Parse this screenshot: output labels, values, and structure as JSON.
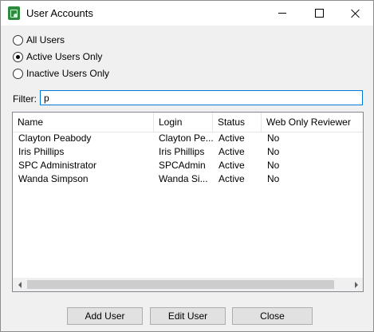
{
  "window": {
    "title": "User Accounts",
    "icon": "user-accounts-app-icon"
  },
  "filter_options": [
    {
      "label": "All Users",
      "checked": false
    },
    {
      "label": "Active Users Only",
      "checked": true
    },
    {
      "label": "Inactive Users Only",
      "checked": false
    }
  ],
  "filter": {
    "label": "Filter:",
    "value": "p"
  },
  "table": {
    "columns": [
      "Name",
      "Login",
      "Status",
      "Web Only Reviewer"
    ],
    "rows": [
      {
        "name": "Clayton Peabody",
        "login": "Clayton Pe...",
        "status": "Active",
        "web_only_reviewer": "No"
      },
      {
        "name": "Iris Phillips",
        "login": "Iris Phillips",
        "status": "Active",
        "web_only_reviewer": "No"
      },
      {
        "name": "SPC Administrator",
        "login": "SPCAdmin",
        "status": "Active",
        "web_only_reviewer": "No"
      },
      {
        "name": "Wanda Simpson",
        "login": "Wanda Si...",
        "status": "Active",
        "web_only_reviewer": "No"
      }
    ]
  },
  "buttons": {
    "add_user": "Add User",
    "edit_user": "Edit User",
    "close": "Close"
  }
}
